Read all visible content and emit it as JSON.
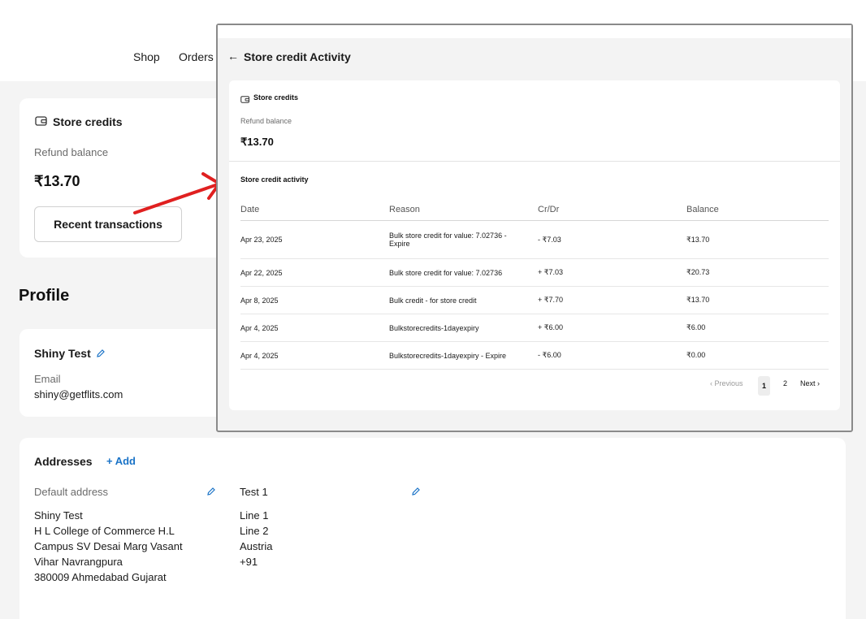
{
  "nav": {
    "shop": "Shop",
    "orders": "Orders"
  },
  "store_credits": {
    "title": "Store credits",
    "subtitle": "Refund balance",
    "amount": "₹13.70",
    "button": "Recent transactions"
  },
  "profile": {
    "heading": "Profile",
    "name": "Shiny Test",
    "email_label": "Email",
    "email": "shiny@getflits.com"
  },
  "addresses": {
    "title": "Addresses",
    "add_label": "+ Add",
    "default_label": "Default address",
    "default_lines": [
      "Shiny Test",
      "H L College of Commerce H.L",
      "Campus SV Desai Marg Vasant",
      "Vihar Navrangpura",
      "380009 Ahmedabad Gujarat"
    ],
    "second_label": "Test 1",
    "second_lines": [
      "Line 1",
      "Line 2",
      "Austria",
      "+91"
    ]
  },
  "overlay": {
    "title": "Store credit Activity",
    "back_icon": "arrow-left-icon",
    "card_title": "Store credits",
    "card_subtitle": "Refund balance",
    "card_amount": "₹13.70",
    "activity_title": "Store credit activity",
    "columns": [
      "Date",
      "Reason",
      "Cr/Dr",
      "Balance"
    ],
    "rows": [
      {
        "date": "Apr 23, 2025",
        "reason": "Bulk store credit for value: 7.02736 - Expire",
        "crdr": "- ₹7.03",
        "type": "debit",
        "balance": "₹13.70"
      },
      {
        "date": "Apr 22, 2025",
        "reason": "Bulk store credit for value: 7.02736",
        "crdr": "+ ₹7.03",
        "type": "credit",
        "balance": "₹20.73"
      },
      {
        "date": "Apr 8, 2025",
        "reason": "Bulk credit - for store credit",
        "crdr": "+ ₹7.70",
        "type": "credit",
        "balance": "₹13.70"
      },
      {
        "date": "Apr 4, 2025",
        "reason": "Bulkstorecredits-1dayexpiry",
        "crdr": "+ ₹6.00",
        "type": "credit",
        "balance": "₹6.00"
      },
      {
        "date": "Apr 4, 2025",
        "reason": "Bulkstorecredits-1dayexpiry - Expire",
        "crdr": "- ₹6.00",
        "type": "debit",
        "balance": "₹0.00"
      }
    ],
    "pagination": {
      "previous": "Previous",
      "page1": "1",
      "page2": "2",
      "next": "Next"
    }
  },
  "colors": {
    "debit": "#d32f2f",
    "credit": "#2e7d32",
    "accent_link": "#1a73c7",
    "annotation_arrow": "#e02020"
  }
}
